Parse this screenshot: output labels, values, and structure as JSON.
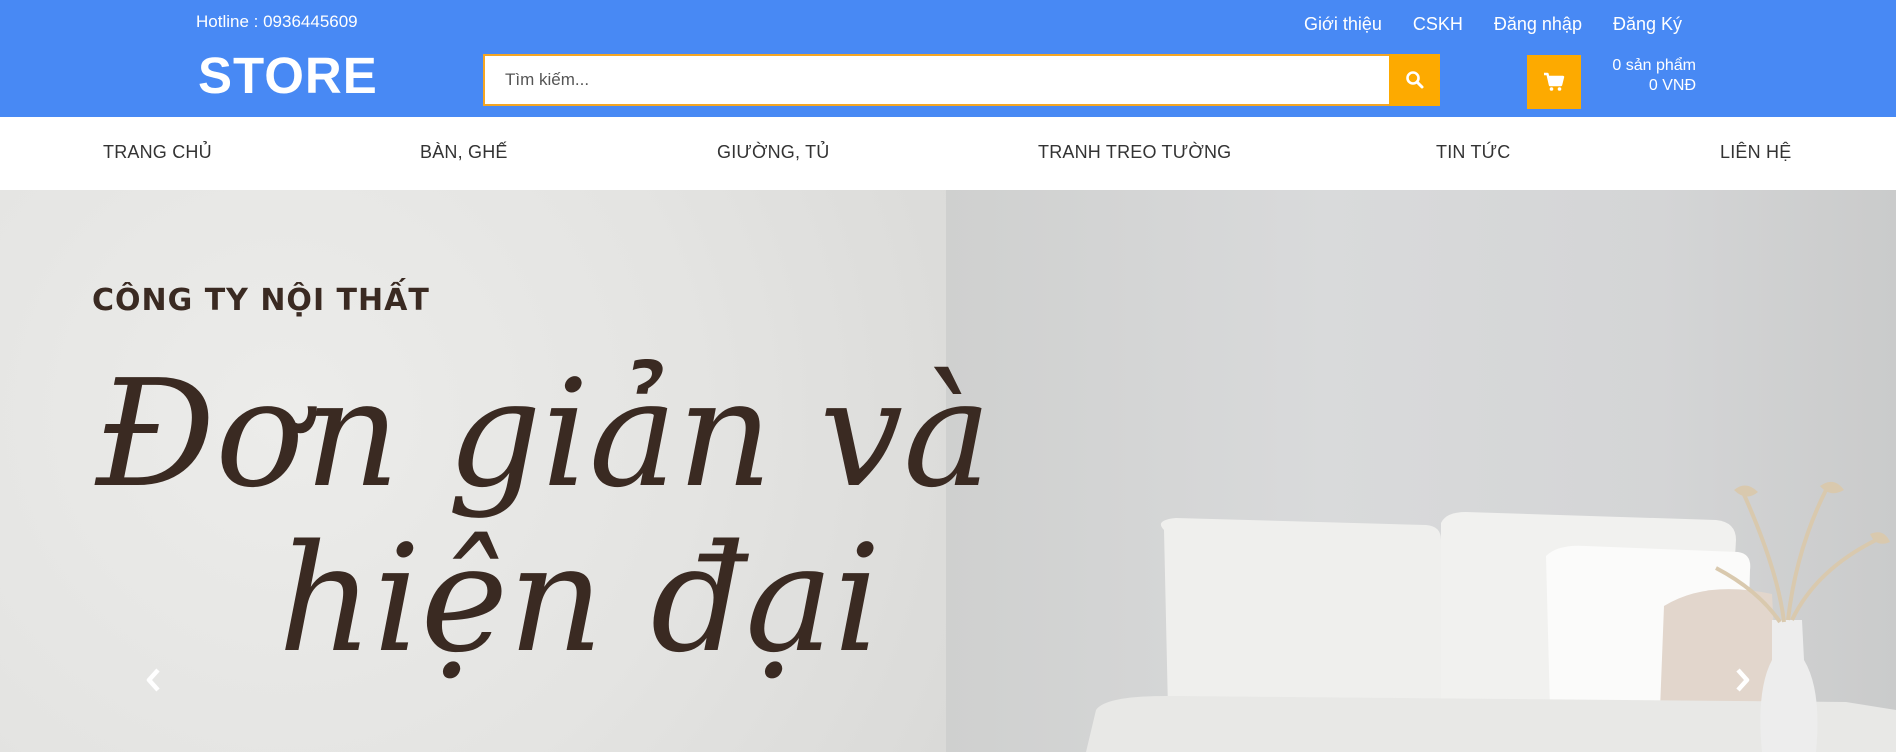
{
  "header": {
    "hotline": "Hotline : 0936445609",
    "logo": "STORE",
    "links": [
      "Giới thiệu",
      "CSKH",
      "Đăng nhập",
      "Đăng Ký"
    ],
    "search": {
      "placeholder": "Tìm kiếm...",
      "icon": "search-icon"
    },
    "cart": {
      "icon": "cart-icon",
      "count_text": "0 sản phẩm",
      "total_text": "0 VNĐ"
    }
  },
  "nav": {
    "items": [
      "TRANG CHỦ",
      "BÀN, GHẾ",
      "GIƯỜNG, TỦ",
      "TRANH TREO TƯỜNG",
      "TIN TỨC",
      "LIÊN HỆ"
    ]
  },
  "hero": {
    "company": "CÔNG TY NỘI THẤT",
    "headline_line1": "Đơn giản và",
    "headline_line2": "hiện đại",
    "prev_icon": "chevron-left-icon",
    "next_icon": "chevron-right-icon"
  },
  "colors": {
    "header_bg": "#4889f4",
    "accent": "#fdaa00",
    "hero_text": "#3a2a22"
  }
}
